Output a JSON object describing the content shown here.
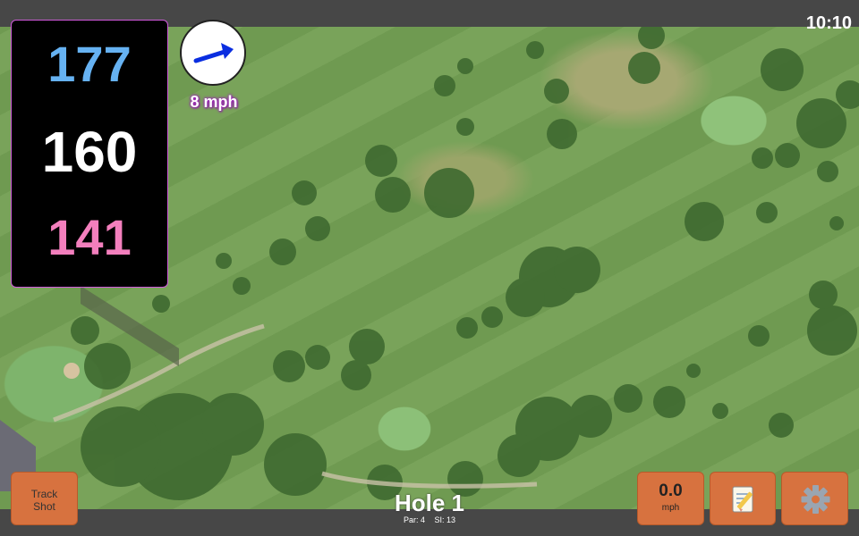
{
  "status_bar": {
    "time": "10:10"
  },
  "distances": {
    "back": "177",
    "middle": "160",
    "front": "141"
  },
  "wind": {
    "speed": "8 mph",
    "direction_icon": "wind-arrow-icon"
  },
  "hole": {
    "title": "Hole 1",
    "par": "Par: 4",
    "stroke_index": "SI: 13"
  },
  "buttons": {
    "track_shot": {
      "line1": "Track",
      "line2": "Shot"
    },
    "speed": {
      "value": "0.0",
      "unit": "mph"
    },
    "scorecard_icon": "notepad-icon",
    "settings_icon": "gear-icon"
  },
  "colors": {
    "back": "#66b2f2",
    "middle": "#ffffff",
    "front": "#f37fbd",
    "button": "#d7723f",
    "box_border": "#d05adb"
  }
}
